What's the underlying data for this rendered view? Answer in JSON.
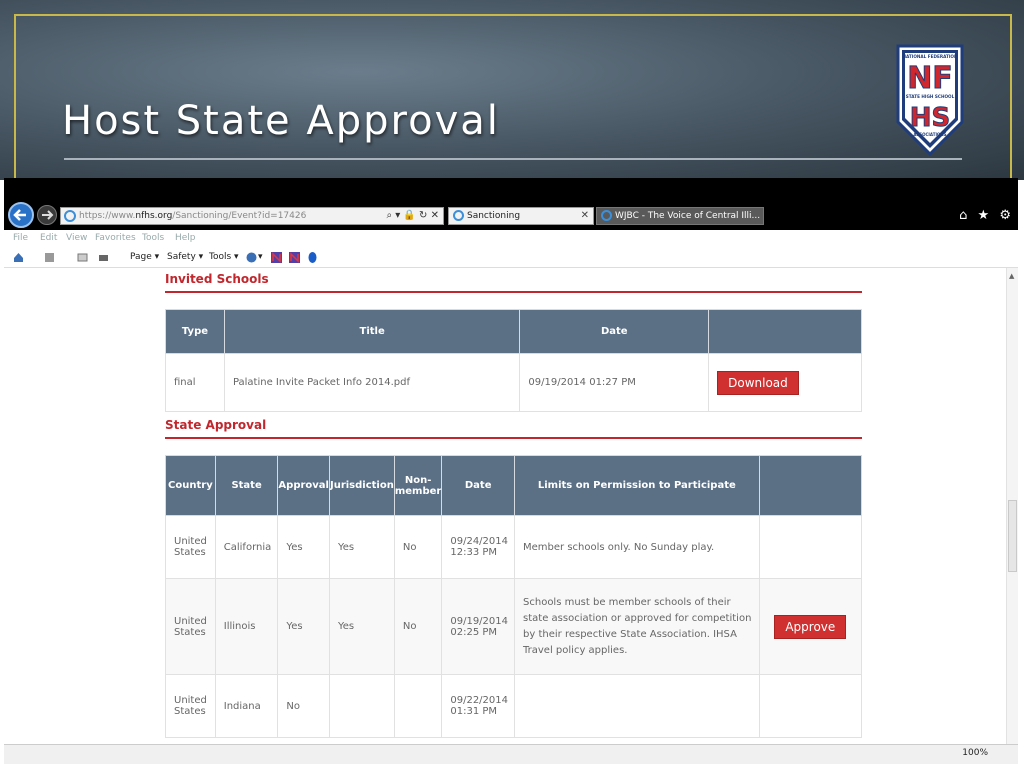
{
  "slide": {
    "title": "Host State Approval",
    "logo_top": "NATIONAL FEDERATION",
    "logo_mid": "STATE HIGH SCHOOL",
    "logo_bottom": "ASSOCIATIONS",
    "logo_letters_top": "NF",
    "logo_letters_bottom": "HS"
  },
  "browser": {
    "url_prefix": "https://www.",
    "url_domain": "nfhs.org",
    "url_rest": "/Sanctioning/Event?id=17426",
    "address_tools": "⌕ ▾ 🔒 ↻ ✕",
    "tabs": [
      {
        "label": "Sanctioning",
        "close": "✕"
      },
      {
        "label": "WJBC - The Voice of Central Illi..."
      }
    ],
    "right_icons": "⌂ ★ ⚙",
    "menu": [
      "File",
      "Edit",
      "View",
      "Favorites",
      "Tools",
      "Help"
    ],
    "commands": [
      "Page ▾",
      "Safety ▾",
      "Tools ▾",
      "▾"
    ],
    "zoom": "100%"
  },
  "invited_schools": {
    "heading": "Invited Schools",
    "columns": [
      "Type",
      "Title",
      "Date",
      ""
    ],
    "rows": [
      {
        "type": "final",
        "title": "Palatine Invite Packet Info 2014.pdf",
        "date": "09/19/2014 01:27 PM",
        "action": "Download"
      }
    ]
  },
  "state_approval": {
    "heading": "State Approval",
    "columns": [
      "Country",
      "State",
      "Approval",
      "Jurisdiction",
      "Non-member",
      "Date",
      "Limits on Permission to Participate",
      ""
    ],
    "rows": [
      {
        "country": "United States",
        "state": "California",
        "approval": "Yes",
        "jurisdiction": "Yes",
        "nonmember": "No",
        "date": "09/24/2014 12:33 PM",
        "limits": "Member schools only. No Sunday play.",
        "action": ""
      },
      {
        "country": "United States",
        "state": "Illinois",
        "approval": "Yes",
        "jurisdiction": "Yes",
        "nonmember": "No",
        "date": "09/19/2014 02:25 PM",
        "limits": "Schools must be member schools of their state association or approved for competition by their respective State Association. IHSA Travel policy applies.",
        "action": "Approve"
      },
      {
        "country": "United States",
        "state": "Indiana",
        "approval": "No",
        "jurisdiction": "",
        "nonmember": "",
        "date": "09/22/2014 01:31 PM",
        "limits": "",
        "action": ""
      }
    ]
  },
  "colors": {
    "accent_red": "#c1272d",
    "table_header": "#5b6f85",
    "button_red": "#d03030"
  }
}
